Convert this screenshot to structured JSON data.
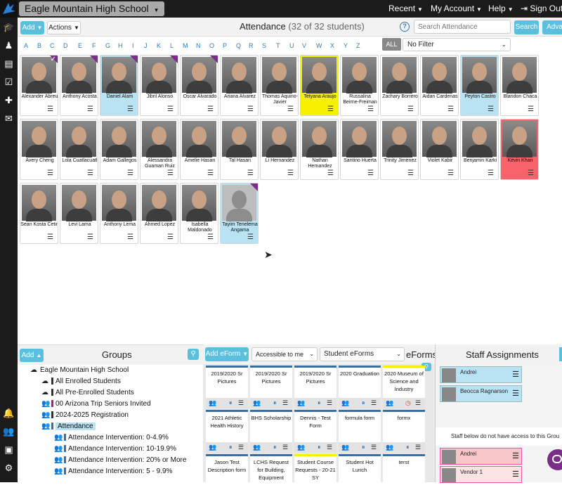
{
  "topbar": {
    "school_name": "Eagle Mountain High School",
    "recent_label": "Recent",
    "my_account_label": "My Account",
    "help_label": "Help",
    "sign_out_label": "Sign Out"
  },
  "toolbar": {
    "add_label": "Add",
    "actions_label": "Actions",
    "title": "Attendance",
    "count_text": "(32 of 32 students)",
    "search_placeholder": "Search Attendance",
    "search_button": "Search",
    "advanced_button": "Adva"
  },
  "alphabet": [
    "A",
    "B",
    "C",
    "D",
    "E",
    "F",
    "G",
    "H",
    "I",
    "J",
    "K",
    "L",
    "M",
    "N",
    "O",
    "P",
    "Q",
    "R",
    "S",
    "T",
    "U",
    "V",
    "W",
    "X",
    "Y",
    "Z"
  ],
  "all_label": "ALL",
  "filter_value": "No Filter",
  "students": [
    {
      "name": "Alexander Abreu",
      "style": "",
      "corner": true,
      "check": true
    },
    {
      "name": "Anthony Acosta",
      "style": "",
      "corner": true
    },
    {
      "name": "Daniel Alam",
      "style": "blue",
      "corner": true
    },
    {
      "name": "Jibril Alonso",
      "style": "",
      "corner": true
    },
    {
      "name": "Oscar Alvarado",
      "style": "",
      "corner": true
    },
    {
      "name": "Ariana Alvarez",
      "style": "",
      "corner": false
    },
    {
      "name": "Thomas Aquino-Javier",
      "style": "",
      "corner": false
    },
    {
      "name": "Tetyana Araujo",
      "style": "yellow",
      "corner": false
    },
    {
      "name": "Russalina Beirne-Freiman",
      "style": "",
      "corner": false
    },
    {
      "name": "Zachary Borrero",
      "style": "",
      "corner": false
    },
    {
      "name": "Aidan Cardenas",
      "style": "",
      "corner": false
    },
    {
      "name": "Peyton Castro",
      "style": "blue",
      "corner": false
    },
    {
      "name": "Blandon Chaca",
      "style": "",
      "corner": false
    },
    {
      "name": "Avery Cheng",
      "style": "",
      "corner": false
    },
    {
      "name": "Lola Cuatlacuatl",
      "style": "",
      "corner": false
    },
    {
      "name": "Adam Gallegos",
      "style": "",
      "corner": false
    },
    {
      "name": "Alessandra Guaman Ruiz",
      "style": "",
      "corner": false
    },
    {
      "name": "Amelie Hasan",
      "style": "",
      "corner": false
    },
    {
      "name": "Tal Hasan",
      "style": "",
      "corner": false
    },
    {
      "name": "Li Hernandez",
      "style": "",
      "corner": false
    },
    {
      "name": "Nathan Hernandez",
      "style": "",
      "corner": false
    },
    {
      "name": "Santino Huerta",
      "style": "",
      "corner": false
    },
    {
      "name": "Trinity Jimenez",
      "style": "",
      "corner": false
    },
    {
      "name": "Violet Kabir",
      "style": "",
      "corner": false
    },
    {
      "name": "Benjamin Karki",
      "style": "",
      "corner": false
    },
    {
      "name": "Kevin Khan",
      "style": "red",
      "corner": false
    },
    {
      "name": "Sean Kosta Cetin",
      "style": "",
      "corner": false
    },
    {
      "name": "Levi Lama",
      "style": "",
      "corner": false
    },
    {
      "name": "Anthony Lema",
      "style": "",
      "corner": false
    },
    {
      "name": "Ahmed Lopez",
      "style": "",
      "corner": false
    },
    {
      "name": "Isabella Maldonado",
      "style": "",
      "corner": false
    },
    {
      "name": "Tayim Tenelema Angama",
      "style": "blue",
      "corner": true,
      "placeholder": true
    }
  ],
  "groups": {
    "add_label": "Add",
    "title": "Groups",
    "items": [
      {
        "label": "Eagle Mountain High School",
        "icon": "cloud-icon",
        "bar": ""
      },
      {
        "label": "All Enrolled Students",
        "icon": "cloud-download-icon",
        "bar": "#333"
      },
      {
        "label": "All Pre-Enrolled Students",
        "icon": "cloud-download-icon",
        "bar": "#333"
      },
      {
        "label": "00 Arizona Trip Seniors Invited",
        "icon": "users-icon",
        "bar": "#c0138a"
      },
      {
        "label": "2024-2025 Registration",
        "icon": "users-icon",
        "bar": "#333"
      },
      {
        "label": "Attendance",
        "icon": "users-icon",
        "bar": "#3a6fa3"
      },
      {
        "label": "Attendance Intervention: 0-4.9%",
        "icon": "users-icon",
        "bar": "#3a6fa3"
      },
      {
        "label": "Attendance Intervention: 10-19.9%",
        "icon": "users-icon",
        "bar": "#3a6fa3"
      },
      {
        "label": "Attendance Intervention: 20% or More",
        "icon": "users-icon",
        "bar": "#3a6fa3"
      },
      {
        "label": "Attendance Intervention: 5 - 9.9%",
        "icon": "users-icon",
        "bar": "#3a6fa3"
      }
    ]
  },
  "eforms": {
    "add_label": "Add eForm",
    "access_value": "Accessible to me",
    "type_value": "Student eForms",
    "title": "eForms",
    "forms": [
      {
        "title": "2019/2020 Sr Pictures",
        "color": "#3a6fa3"
      },
      {
        "title": "2019/2020 Sr Pictures",
        "color": "#3a6fa3"
      },
      {
        "title": "2019/2020 Sr Pictures",
        "color": "#3a6fa3"
      },
      {
        "title": "2020 Graduation",
        "color": "#3a6fa3"
      },
      {
        "title": "2020 Museum of Science and Industry",
        "color": "#f6f100"
      },
      {
        "title": "2021 Athletic Health History",
        "color": "#3a6fa3"
      },
      {
        "title": "BHS Scholarship",
        "color": "#3a6fa3"
      },
      {
        "title": "Dennis - Test Form",
        "color": "#3a6fa3"
      },
      {
        "title": "formula form",
        "color": "#3a6fa3"
      },
      {
        "title": "formx",
        "color": "#3a6fa3"
      },
      {
        "title": "Jason Test Description form",
        "color": "#3a6fa3"
      },
      {
        "title": "LCHS Request for Building, Equipment",
        "color": "#3a6fa3"
      },
      {
        "title": "Student Course Requests - 20-21 SY",
        "color": "#f6f100"
      },
      {
        "title": "Student Hot Lunch",
        "color": "#3a6fa3"
      },
      {
        "title": "terst",
        "color": "#3a6fa3"
      }
    ]
  },
  "staff": {
    "title": "Staff Assignments",
    "assigned": [
      {
        "name": "Andrei"
      },
      {
        "name": "Beocca Ragnarson"
      }
    ],
    "no_access_text": "Staff below do not have access to this Grou",
    "others": [
      {
        "name": "Andrei"
      },
      {
        "name": "Vendor 1"
      }
    ]
  },
  "colors": {
    "accent": "#5bc0de",
    "dark": "#1b1b1b",
    "highlight_blue": "#b9e2f3",
    "highlight_yellow": "#f6f100",
    "highlight_red": "#f6636b",
    "corner_purple": "#7a2e8a"
  }
}
